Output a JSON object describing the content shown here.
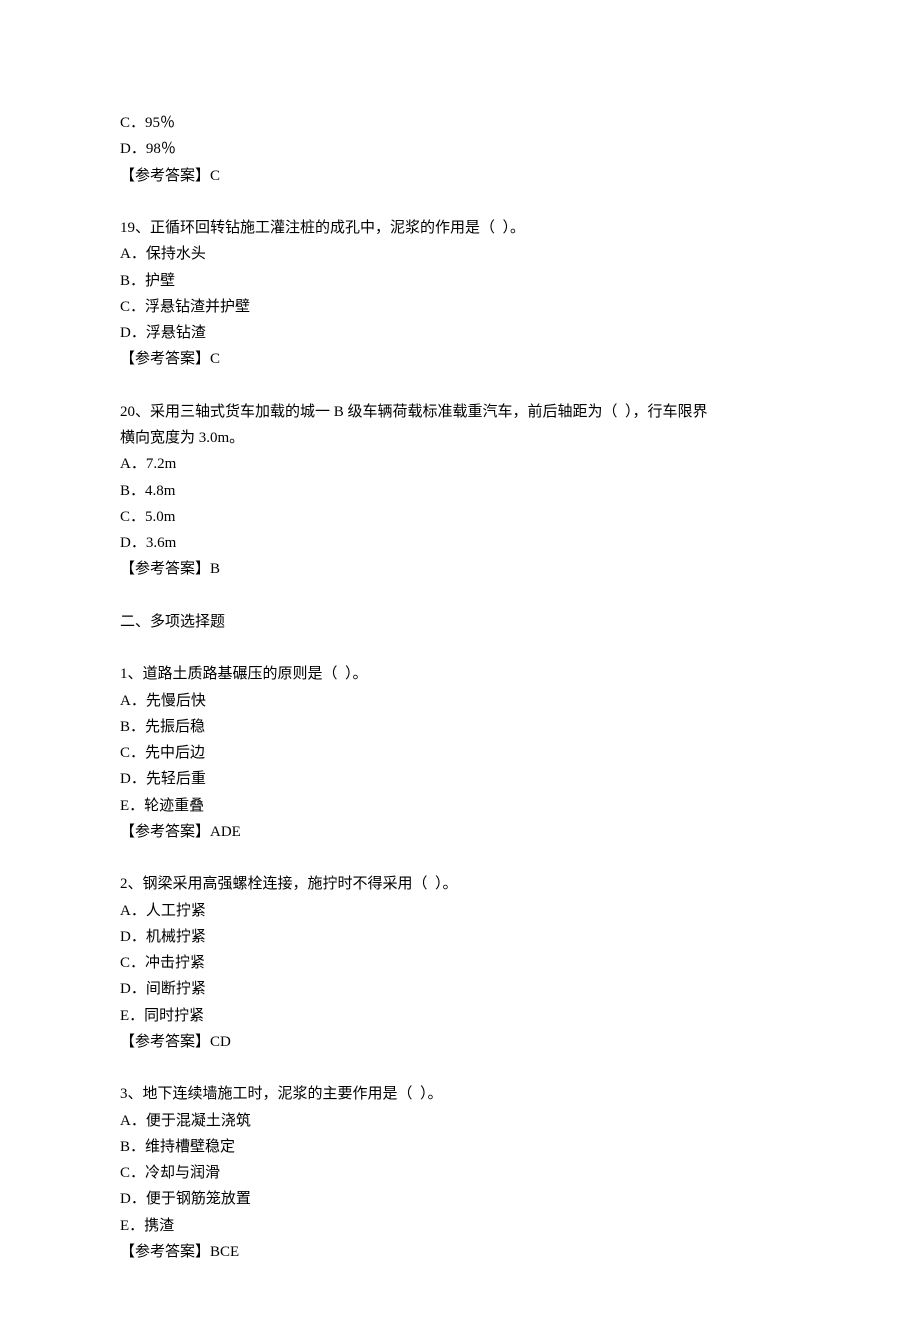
{
  "q18_tail": {
    "options": [
      "C．95％",
      "D．98％"
    ],
    "answer": "【参考答案】C"
  },
  "q19": {
    "stem": "19、正循环回转钻施工灌注桩的成孔中，泥浆的作用是（  ）。",
    "options": [
      "A．保持水头",
      "B．护壁",
      "C．浮悬钻渣并护壁",
      "D．浮悬钻渣"
    ],
    "answer": "【参考答案】C"
  },
  "q20": {
    "stem_line1": "20、采用三轴式货车加载的城一 B 级车辆荷载标准载重汽车，前后轴距为（  ），行车限界",
    "stem_line2": "横向宽度为 3.0m。",
    "options": [
      "A．7.2m",
      "B．4.8m",
      "C．5.0m",
      "D．3.6m"
    ],
    "answer": "【参考答案】B"
  },
  "section2_heading": "二、多项选择题",
  "mq1": {
    "stem": "1、道路土质路基碾压的原则是（  ）。",
    "options": [
      "A．先慢后快",
      "B．先振后稳",
      "C．先中后边",
      "D．先轻后重",
      "E．轮迹重叠"
    ],
    "answer": "【参考答案】ADE"
  },
  "mq2": {
    "stem": "2、钢梁采用高强螺栓连接，施拧时不得采用（  ）。",
    "options": [
      "A．人工拧紧",
      "D．机械拧紧",
      "C．冲击拧紧",
      "D．间断拧紧",
      "E．同时拧紧"
    ],
    "answer": "【参考答案】CD"
  },
  "mq3": {
    "stem": "3、地下连续墙施工时，泥浆的主要作用是（  ）。",
    "options": [
      "A．便于混凝土浇筑",
      "B．维持槽壁稳定",
      "C．冷却与润滑",
      "D．便于钢筋笼放置",
      "E．携渣"
    ],
    "answer": "【参考答案】BCE"
  }
}
